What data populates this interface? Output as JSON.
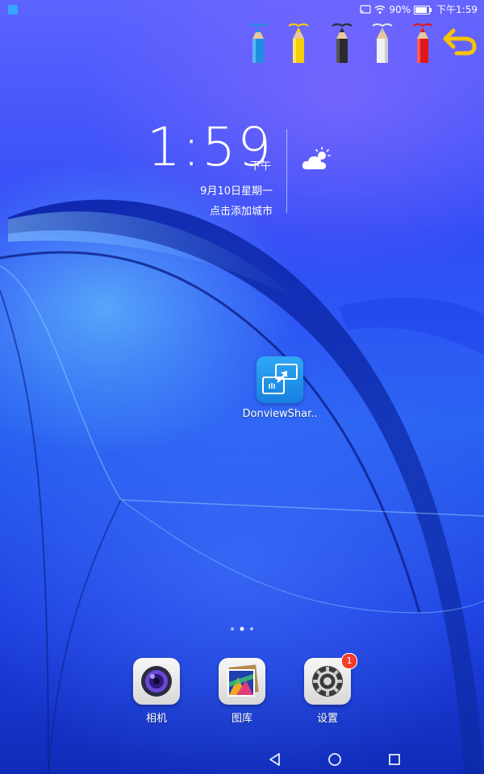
{
  "status_bar": {
    "battery": "90%",
    "time": "下午1:59",
    "icons": [
      "cast-icon",
      "wifi-icon",
      "battery-icon"
    ]
  },
  "toolbar": {
    "pencils": [
      {
        "name": "blue-pencil",
        "color": "#1e8fe0"
      },
      {
        "name": "yellow-pencil",
        "color": "#f5cd00"
      },
      {
        "name": "black-pencil",
        "color": "#2b2b2b"
      },
      {
        "name": "white-pencil",
        "color": "#f2f2f2"
      },
      {
        "name": "red-pencil",
        "color": "#e01818"
      }
    ],
    "undo_icon": "undo-arrow-icon",
    "undo_color": "#f5c400"
  },
  "clock_widget": {
    "time": "1:59",
    "ampm": "下午",
    "date": "9月10日星期一",
    "city_prompt": "点击添加城市",
    "weather_icon": "partly-cloudy-icon"
  },
  "desktop_apps": [
    {
      "label": "DonviewShar..",
      "icon": "donview-share-icon"
    }
  ],
  "page_indicator": {
    "current": 2,
    "total": 3
  },
  "dock": [
    {
      "label": "相机",
      "icon": "camera-icon"
    },
    {
      "label": "图库",
      "icon": "gallery-icon"
    },
    {
      "label": "设置",
      "icon": "settings-gear-icon",
      "badge": "1"
    }
  ],
  "nav_bar": [
    "back-icon",
    "home-icon",
    "recents-icon"
  ]
}
